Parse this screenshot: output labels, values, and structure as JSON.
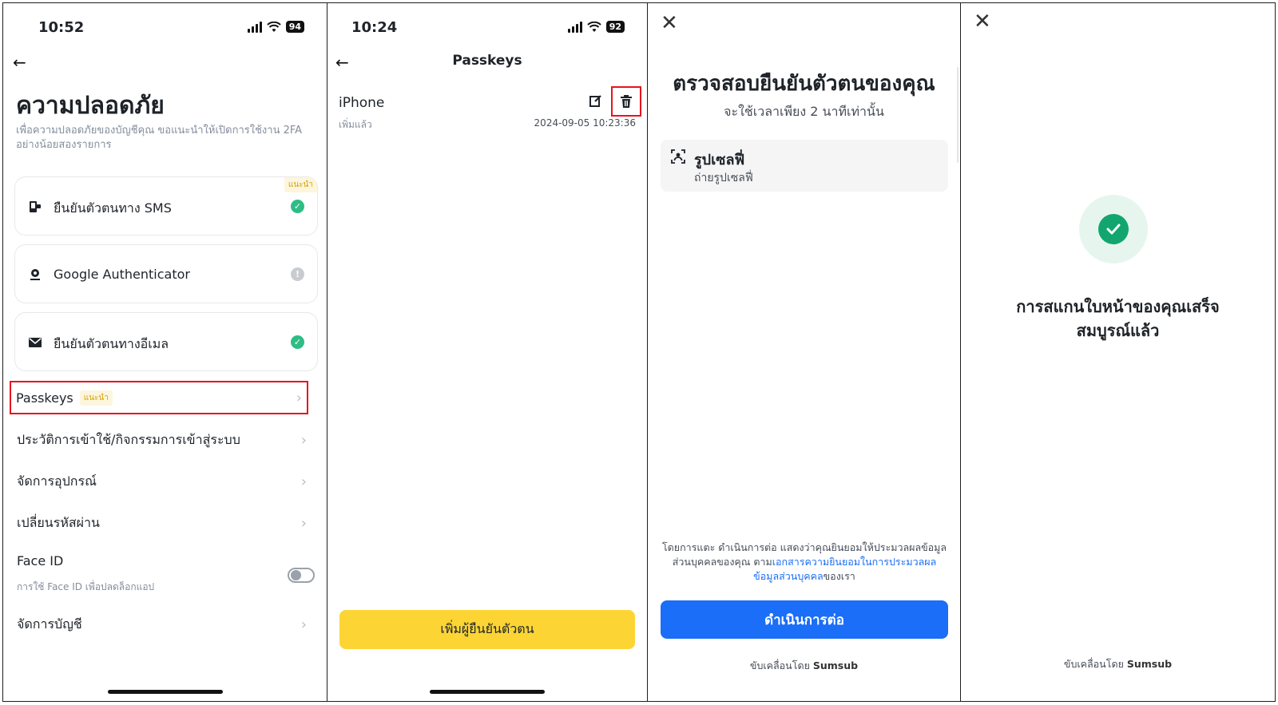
{
  "panel1": {
    "status_time": "10:52",
    "battery": "94",
    "title": "ความปลอดภัย",
    "description": "เพื่อความปลอดภัยของบัญชีคุณ ขอแนะนำให้เปิดการใช้งาน 2FA อย่างน้อยสองรายการ",
    "recommended_badge": "แนะนำ",
    "cards": [
      {
        "label": "ยืนยันตัวตนทาง SMS",
        "icon": "phone-sms-icon",
        "status": "enabled"
      },
      {
        "label": "Google Authenticator",
        "icon": "authenticator-icon",
        "status": "warning"
      },
      {
        "label": "ยืนยันตัวตนทางอีเมล",
        "icon": "email-icon",
        "status": "enabled"
      }
    ],
    "passkeys_label": "Passkeys",
    "passkeys_badge": "แนะนำ",
    "rows": [
      {
        "label": "ประวัติการเข้าใช้/กิจกรรมการเข้าสู่ระบบ"
      },
      {
        "label": "จัดการอุปกรณ์"
      },
      {
        "label": "เปลี่ยนรหัสผ่าน"
      }
    ],
    "faceid_label": "Face ID",
    "faceid_sub": "การใช้ Face ID เพื่อปลดล็อกแอป",
    "faceid_enabled": false,
    "manage_account": "จัดการบัญชี"
  },
  "panel2": {
    "status_time": "10:24",
    "battery": "92",
    "title": "Passkeys",
    "passkey_name": "iPhone",
    "passkey_sub": "เพิ่มแล้ว",
    "passkey_date": "2024-09-05 10:23:36",
    "add_button": "เพิ่มผู้ยืนยันตัวตน"
  },
  "panel3": {
    "title": "ตรวจสอบยืนยันตัวตนของคุณ",
    "subtitle": "จะใช้เวลาเพียง 2 นาทีเท่านั้น",
    "selfie_title": "รูปเซลฟี่",
    "selfie_sub": "ถ่ายรูปเซลฟี่",
    "consent_prefix": "โดยการแตะ ดำเนินการต่อ แสดงว่าคุณยินยอมให้ประมวลผลข้อมูลส่วนบุคคลของคุณ ตาม",
    "consent_link": "เอกสารความยินยอมในการประมวลผลข้อมูลส่วนบุคคล",
    "consent_suffix": "ของเรา",
    "continue_button": "ดำเนินการต่อ",
    "powered_prefix": "ขับเคลื่อนโดย",
    "powered_brand": "Sumsub"
  },
  "panel4": {
    "success_line1": "การสแกนใบหน้าของคุณเสร็จ",
    "success_line2": "สมบูรณ์แล้ว",
    "powered_prefix": "ขับเคลื่อนโดย",
    "powered_brand": "Sumsub"
  },
  "colors": {
    "accent_yellow": "#fcd535",
    "success_green": "#2ebd85",
    "highlight_red": "#e5141f",
    "primary_blue": "#1a6ef7"
  }
}
